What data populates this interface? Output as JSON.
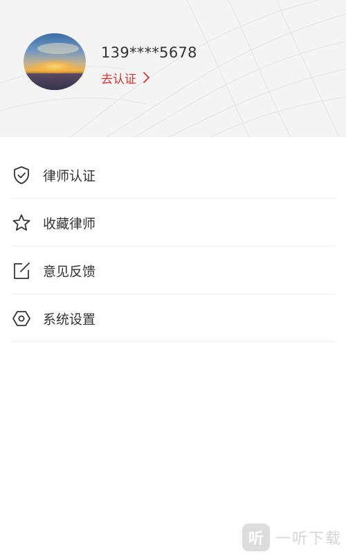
{
  "profile": {
    "phone": "139****5678",
    "verify_label": "去认证",
    "avatar_icon": "sunset-avatar-image"
  },
  "menu": {
    "items": [
      {
        "label": "律师认证",
        "icon": "shield-check-icon"
      },
      {
        "label": "收藏律师",
        "icon": "star-icon"
      },
      {
        "label": "意见反馈",
        "icon": "edit-icon"
      },
      {
        "label": "系统设置",
        "icon": "settings-hexagon-icon"
      }
    ]
  },
  "watermark": {
    "badge": "听",
    "text": "一听下载"
  },
  "colors": {
    "accent": "#e0322b",
    "text": "#333333",
    "header_bg": "#f4f4f4",
    "divider": "#eeeeee"
  }
}
